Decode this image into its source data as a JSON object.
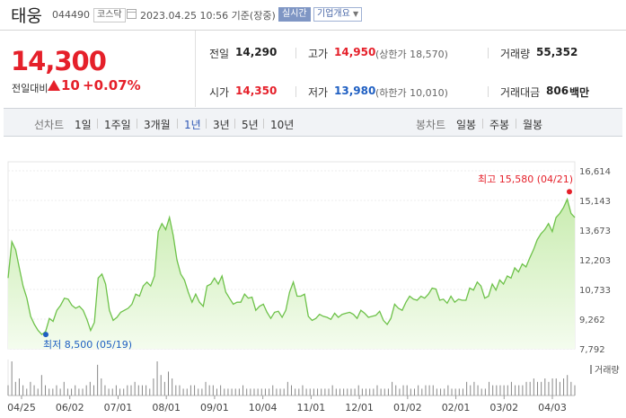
{
  "header": {
    "name": "태웅",
    "code": "044490",
    "market": "코스닥",
    "timestamp": "2023.04.25 10:56  기준(장중)",
    "live_badge": "실시간",
    "info_badge": "기업개요"
  },
  "quote": {
    "price": "14,300",
    "change_label": "전일대비",
    "change_value": "10",
    "change_pct": "+0.07%",
    "prev_close_label": "전일",
    "prev_close": "14,290",
    "high_label": "고가",
    "high": "14,950",
    "upper_limit": "(상한가 18,570)",
    "volume_label": "거래량",
    "volume": "55,352",
    "open_label": "시가",
    "open": "14,350",
    "low_label": "저가",
    "low": "13,980",
    "lower_limit": "(하한가 10,010)",
    "amount_label": "거래대금",
    "amount": "806",
    "amount_unit": "백만"
  },
  "periods": {
    "line_label": "선차트",
    "line_items": [
      "1일",
      "1주일",
      "3개월",
      "1년",
      "3년",
      "5년",
      "10년"
    ],
    "active": "1년",
    "candle_label": "봉차트",
    "candle_items": [
      "일봉",
      "주봉",
      "월봉"
    ]
  },
  "chart_data": {
    "type": "area",
    "y_ticks": [
      "16,614",
      "15,143",
      "13,673",
      "12,203",
      "10,733",
      "9,262",
      "7,792"
    ],
    "ylim": [
      7792,
      16614
    ],
    "x_ticks": [
      "04/25",
      "06/02",
      "07/01",
      "08/01",
      "09/01",
      "10/04",
      "11/01",
      "12/01",
      "01/02",
      "02/01",
      "03/02",
      "04/03"
    ],
    "grid": true,
    "high_label": "최고 15,580 (04/21)",
    "low_label": "최저 8,500 (05/19)",
    "volume_label": "거래량",
    "colors": {
      "line": "#6ec24a",
      "fill_top": "#c9ecb0",
      "fill_bottom": "#f4fcee",
      "high": "#e5202a",
      "low": "#1f5fc2"
    },
    "values": [
      11300,
      13100,
      12700,
      11800,
      10900,
      10300,
      9400,
      9000,
      8700,
      8500,
      8650,
      9300,
      9150,
      9700,
      9950,
      10300,
      10250,
      9950,
      9800,
      9900,
      9700,
      9250,
      8700,
      9100,
      11300,
      11500,
      11000,
      9700,
      9200,
      9350,
      9600,
      9700,
      9800,
      10000,
      10500,
      10400,
      10900,
      11100,
      10900,
      11400,
      13600,
      14000,
      13700,
      14300,
      13400,
      12200,
      11500,
      11200,
      10600,
      10100,
      10500,
      10100,
      9900,
      10900,
      11000,
      11300,
      11000,
      11400,
      10600,
      10300,
      10000,
      10100,
      10100,
      10500,
      10300,
      10350,
      9700,
      9900,
      10000,
      9600,
      9300,
      9600,
      9650,
      9350,
      9700,
      10600,
      11100,
      10400,
      10400,
      10500,
      9400,
      9200,
      9300,
      9500,
      9400,
      9350,
      9250,
      9550,
      9350,
      9500,
      9550,
      9600,
      9500,
      9300,
      9700,
      9550,
      9350,
      9400,
      9450,
      9650,
      9200,
      9000,
      9300,
      10000,
      9800,
      9700,
      10100,
      10400,
      10250,
      10200,
      10400,
      10300,
      10500,
      10800,
      10750,
      10200,
      10250,
      10050,
      10400,
      10100,
      10250,
      10200,
      10200,
      10800,
      10700,
      11100,
      10900,
      10300,
      10400,
      11000,
      10700,
      11200,
      11000,
      11400,
      11300,
      11800,
      11600,
      12000,
      11850,
      12300,
      12700,
      13200,
      13500,
      13700,
      14000,
      13600,
      14300,
      14500,
      14800,
      15200,
      14500,
      14300
    ],
    "volume": [
      3,
      10,
      4,
      5,
      3,
      2,
      4,
      3,
      2,
      6,
      3,
      2,
      2,
      3,
      2,
      4,
      2,
      2,
      3,
      2,
      2,
      3,
      4,
      3,
      9,
      5,
      3,
      2,
      2,
      3,
      2,
      2,
      3,
      3,
      4,
      3,
      3,
      3,
      2,
      5,
      10,
      6,
      4,
      7,
      5,
      3,
      3,
      2,
      2,
      3,
      3,
      2,
      2,
      4,
      3,
      3,
      2,
      3,
      2,
      2,
      2,
      2,
      2,
      3,
      2,
      2,
      2,
      2,
      2,
      2,
      2,
      3,
      2,
      2,
      2,
      4,
      3,
      2,
      2,
      3,
      2,
      2,
      2,
      2,
      2,
      2,
      2,
      3,
      2,
      2,
      2,
      2,
      2,
      2,
      3,
      2,
      2,
      2,
      2,
      3,
      2,
      2,
      2,
      4,
      3,
      2,
      3,
      3,
      2,
      2,
      3,
      2,
      3,
      3,
      3,
      2,
      2,
      2,
      3,
      2,
      2,
      2,
      2,
      4,
      3,
      4,
      3,
      2,
      2,
      4,
      3,
      3,
      3,
      3,
      3,
      4,
      3,
      3,
      3,
      4,
      4,
      5,
      4,
      4,
      5,
      4,
      5,
      5,
      4,
      5,
      6,
      4,
      3
    ]
  }
}
